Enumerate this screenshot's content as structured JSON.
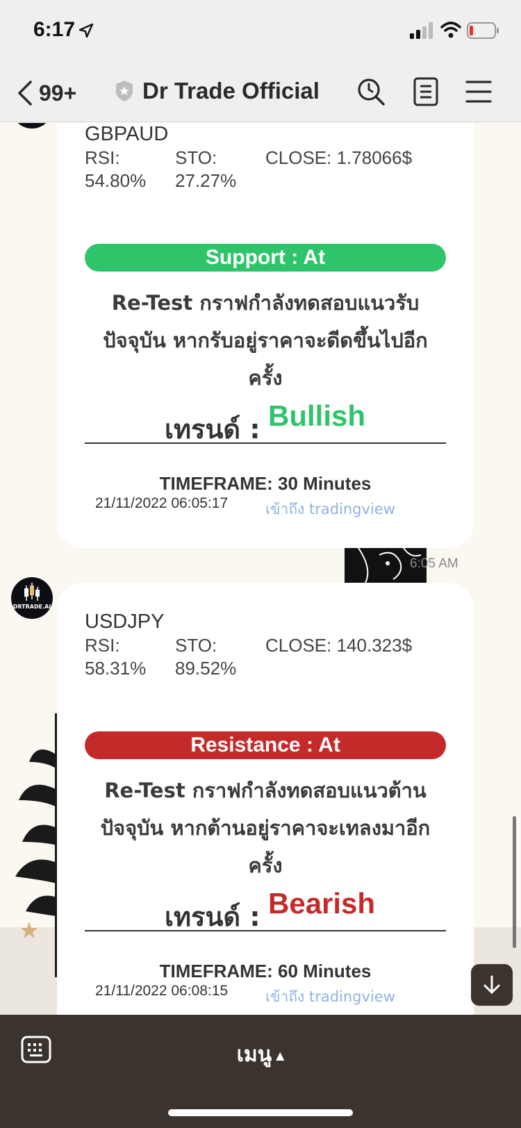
{
  "status_bar": {
    "time": "6:17"
  },
  "nav": {
    "back_count": "99+",
    "title": "Dr Trade Official"
  },
  "avatar_label": "DRTRADE.AI",
  "messages": [
    {
      "pair": "GBPAUD",
      "rsi_label": "RSI:",
      "rsi_value": "54.80%",
      "sto_label": "STO:",
      "sto_value": "27.27%",
      "close": "CLOSE: 1.78066$",
      "zone": "Support : At",
      "desc_line1": "Re-Test กราฟกำลังทดสอบแนวรับ",
      "desc_line2": "ปัจจุบัน หากรับอยู่ราคาจะดีดขึ้นไปอีก",
      "desc_line3": "ครั้ง",
      "trend_label": "เทรนด์ :",
      "trend_value": "Bullish",
      "timeframe": "TIMEFRAME: 30 Minutes",
      "timestamp": "21/11/2022 06:05:17",
      "link": "เข้าถึง tradingview"
    },
    {
      "pair": "USDJPY",
      "rsi_label": "RSI:",
      "rsi_value": "58.31%",
      "sto_label": "STO:",
      "sto_value": "89.52%",
      "close": "CLOSE: 140.323$",
      "zone": "Resistance : At",
      "desc_line1": "Re-Test กราฟกำลังทดสอบแนวต้าน",
      "desc_line2": "ปัจจุบัน หากต้านอยู่ราคาจะเทลงมาอีก",
      "desc_line3": "ครั้ง",
      "trend_label": "เทรนด์ :",
      "trend_value": "Bearish",
      "timeframe": "TIMEFRAME: 60 Minutes",
      "timestamp": "21/11/2022 06:08:15",
      "link": "เข้าถึง tradingview"
    }
  ],
  "message_time": "6:05 AM",
  "bottom_bar": {
    "menu_label": "เมนู"
  },
  "colors": {
    "bullish": "#30c46a",
    "bearish": "#c52a2a",
    "bottom_bar": "#3a332e"
  }
}
